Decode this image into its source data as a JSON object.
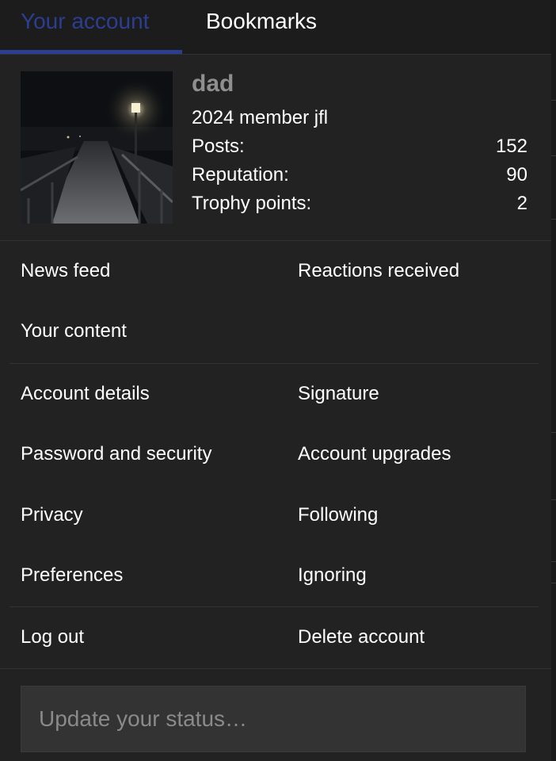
{
  "tabs": {
    "your_account": "Your account",
    "bookmarks": "Bookmarks"
  },
  "profile": {
    "avatar_alt": "Snowy boardwalk at night with a street lamp",
    "username": "dad",
    "member_title": "2024 member jfl",
    "stats": [
      {
        "label": "Posts:",
        "value": "152"
      },
      {
        "label": "Reputation:",
        "value": "90"
      },
      {
        "label": "Trophy points:",
        "value": "2"
      }
    ]
  },
  "menu": {
    "news_feed": "News feed",
    "reactions_received": "Reactions received",
    "your_content": "Your content",
    "account_details": "Account details",
    "signature": "Signature",
    "password_and_security": "Password and security",
    "account_upgrades": "Account upgrades",
    "privacy": "Privacy",
    "following": "Following",
    "preferences": "Preferences",
    "ignoring": "Ignoring",
    "log_out": "Log out",
    "delete_account": "Delete account"
  },
  "status": {
    "placeholder": "Update your status…",
    "value": ""
  },
  "colors": {
    "accent": "#2b3e91",
    "background": "#222222",
    "username": "#8f8f8f"
  }
}
